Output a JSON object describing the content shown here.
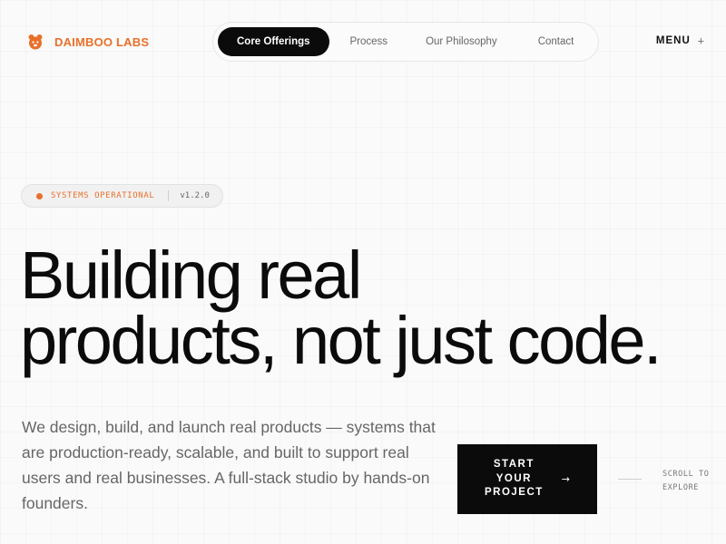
{
  "brand": {
    "name": "DAIMBOO LABS",
    "icon": "bear-logo-icon",
    "accent_color": "#e8702a"
  },
  "nav": {
    "items": [
      {
        "label": "Core Offerings",
        "active": true
      },
      {
        "label": "Process",
        "active": false
      },
      {
        "label": "Our Philosophy",
        "active": false
      },
      {
        "label": "Contact",
        "active": false
      }
    ]
  },
  "menu": {
    "label": "MENU",
    "icon": "+"
  },
  "status": {
    "text": "SYSTEMS OPERATIONAL",
    "version": "v1.2.0",
    "dot_color": "#e8702a"
  },
  "hero": {
    "headline_line1": "Building real",
    "headline_line2": "products, not just code.",
    "description": "We design, build, and launch real products — systems that are production-ready, scalable, and built to support real users and real businesses. A full-stack studio by hands-on founders."
  },
  "cta": {
    "label": "START\nYOUR\nPROJECT",
    "icon": "→"
  },
  "scroll_hint": {
    "label": "SCROLL TO\nEXPLORE"
  }
}
